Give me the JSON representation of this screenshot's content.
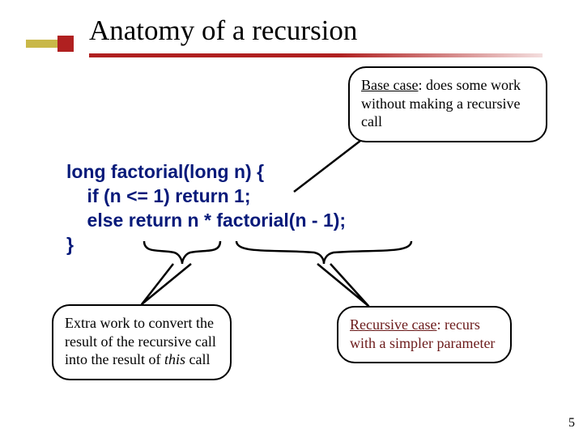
{
  "title": "Anatomy of a recursion",
  "callouts": {
    "base": {
      "label": "Base case",
      "rest": ": does some work without making a recursive call"
    },
    "extra": {
      "text_html": "Extra work to convert the result of the recursive call into the result of <i>this</i> call"
    },
    "recursive": {
      "label": "Recursive case",
      "rest": ": recurs with a simpler parameter"
    }
  },
  "code": {
    "line1": "long factorial(long n) {",
    "line2": "    if (n <= 1) return 1;",
    "line3": "    else return n * factorial(n - 1);",
    "line4": "}"
  },
  "page_number": "5"
}
